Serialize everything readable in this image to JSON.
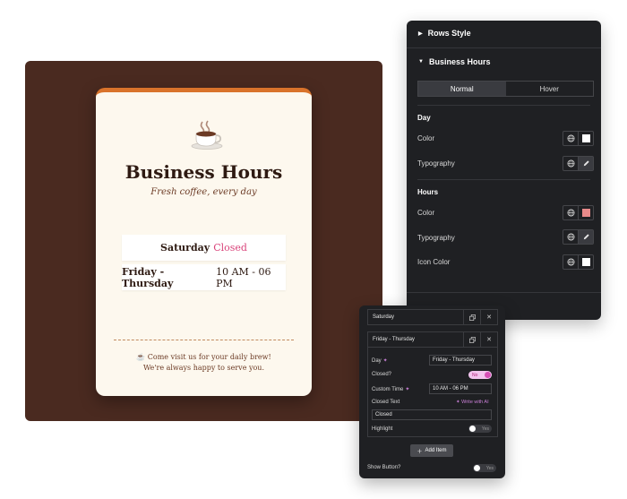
{
  "preview": {
    "card": {
      "title": "Business Hours",
      "subtitle": "Fresh coffee, every day",
      "rows": [
        {
          "day": "Saturday",
          "time": "",
          "status": "Closed"
        },
        {
          "day": "Friday - Thursday",
          "time": "10 AM - 06 PM",
          "status": ""
        }
      ],
      "footer_line1": "☕ Come visit us for your daily brew!",
      "footer_line2": "We're always happy to serve you.",
      "icon": "coffee-cup-icon",
      "accent_color": "#d9732b",
      "closed_color": "#d9437a"
    },
    "background_color": "#4a2a20"
  },
  "style_panel": {
    "rows_style_label": "Rows Style",
    "business_hours_label": "Business Hours",
    "tabs": {
      "normal": "Normal",
      "hover": "Hover"
    },
    "day_group": {
      "label": "Day",
      "color_label": "Color",
      "typography_label": "Typography",
      "color_value": "#ffffff"
    },
    "hours_group": {
      "label": "Hours",
      "color_label": "Color",
      "typography_label": "Typography",
      "icon_color_label": "Icon Color",
      "color_value": "#e88a8a",
      "icon_color_value": "#ffffff"
    }
  },
  "repeater_panel": {
    "items": [
      {
        "name": "Saturday"
      },
      {
        "name": "Friday - Thursday"
      }
    ],
    "fields": {
      "day_label": "Day",
      "day_value": "Friday - Thursday",
      "closed_label": "Closed?",
      "closed_toggle": "No",
      "custom_time_label": "Custom Time",
      "custom_time_value": "10 AM - 06 PM",
      "closed_text_label": "Closed Text",
      "write_ai_label": "Write with AI",
      "closed_text_value": "Closed",
      "highlight_label": "Highlight",
      "highlight_toggle": "Yes"
    },
    "add_item_label": "Add Item",
    "show_button_label": "Show Button?",
    "show_button_toggle": "Yes"
  }
}
